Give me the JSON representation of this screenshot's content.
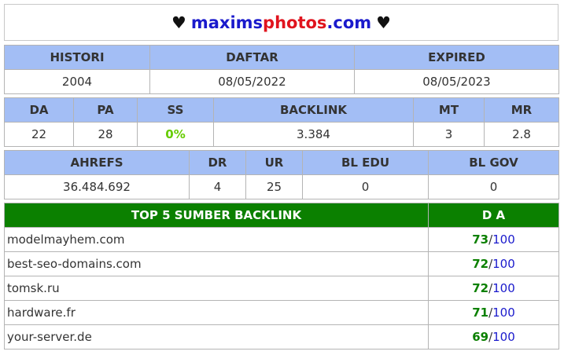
{
  "header": {
    "heart_left": "♥",
    "domain_part1": "maxims",
    "domain_part2": "photos",
    "domain_part3": ".com",
    "heart_right": "♥"
  },
  "registration": {
    "headers": [
      "HISTORI",
      "DAFTAR",
      "EXPIRED"
    ],
    "values": [
      "2004",
      "08/05/2022",
      "08/05/2023"
    ]
  },
  "metrics": {
    "headers": [
      "DA",
      "PA",
      "SS",
      "BACKLINK",
      "MT",
      "MR"
    ],
    "values": [
      "22",
      "28",
      "0%",
      "3.384",
      "3",
      "2.8"
    ]
  },
  "seo": {
    "headers": [
      "AHREFS",
      "DR",
      "UR",
      "BL EDU",
      "BL GOV"
    ],
    "values": [
      "36.484.692",
      "4",
      "25",
      "0",
      "0"
    ]
  },
  "backlinks": {
    "header_source": "TOP 5 SUMBER BACKLINK",
    "header_da": "D A",
    "separator": "/",
    "max": "100",
    "rows": [
      {
        "domain": "modelmayhem.com",
        "score": "73"
      },
      {
        "domain": "best-seo-domains.com",
        "score": "72"
      },
      {
        "domain": "tomsk.ru",
        "score": "72"
      },
      {
        "domain": "hardware.fr",
        "score": "71"
      },
      {
        "domain": "your-server.de",
        "score": "69"
      }
    ]
  },
  "colors": {
    "header_blue": "#a3bef5",
    "header_green": "#0b8000",
    "domain_blue": "#1a1acc",
    "domain_red": "#e0141e",
    "ss_green": "#66cc00"
  }
}
